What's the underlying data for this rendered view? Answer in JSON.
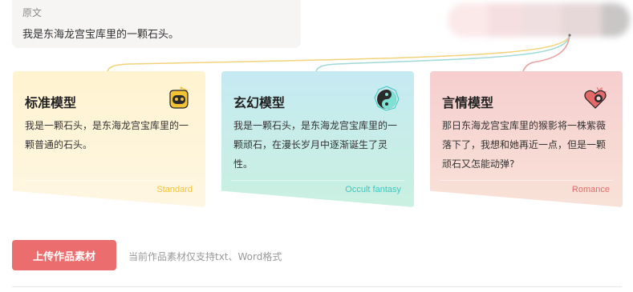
{
  "source": {
    "label": "原文",
    "text": "我是东海龙宫宝库里的一颗石头。"
  },
  "models": [
    {
      "title": "标准模型",
      "text": "我是一颗石头，是东海龙宫宝库里的一颗普通的石头。",
      "tag": "Standard",
      "icon": "robot-face-icon",
      "accent": "#f2c335"
    },
    {
      "title": "玄幻模型",
      "text": "我是一颗石头，是东海龙宫宝库里的一颗顽石，在漫长岁月中逐渐诞生了灵性。",
      "tag": "Occult fantasy",
      "icon": "yin-yang-icon",
      "accent": "#3dc6bf"
    },
    {
      "title": "言情模型",
      "text": "那日东海龙宫宝库里的猴影将一株紫薇落下了，我想和她再近一点，但是一颗顽石又怎能动弹?",
      "tag": "Romance",
      "icon": "heart-icon",
      "accent": "#e46a6a"
    }
  ],
  "upload": {
    "button_label": "上传作品素材",
    "hint": "当前作品素材仅支持txt、Word格式"
  },
  "colors": {
    "primary": "#ec6d6d",
    "standard": "#f2c335",
    "occult": "#3dc6bf",
    "romance": "#e46a6a"
  }
}
